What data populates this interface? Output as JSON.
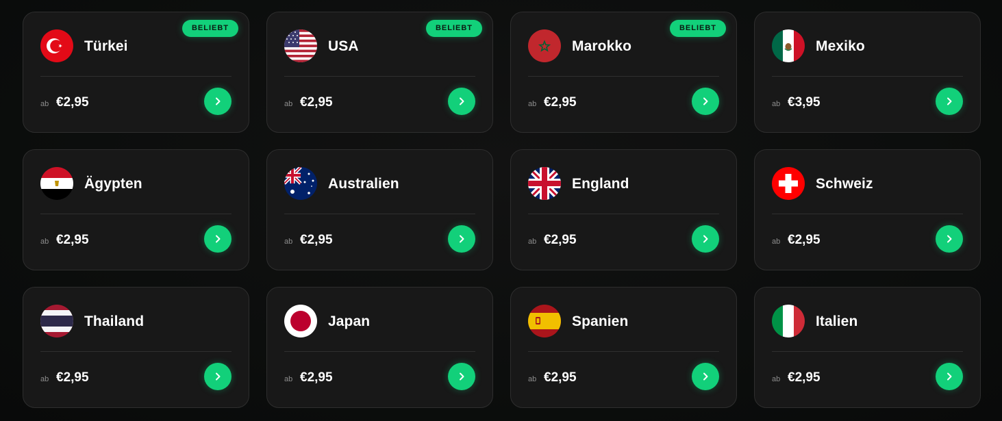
{
  "accent_color": "#12d07a",
  "price_prefix": "ab",
  "countries": [
    {
      "name": "Türkei",
      "price": "€2,95",
      "badge": "BELIEBT",
      "flag_icon": "turkey-flag-icon"
    },
    {
      "name": "USA",
      "price": "€2,95",
      "badge": "BELIEBT",
      "flag_icon": "usa-flag-icon"
    },
    {
      "name": "Marokko",
      "price": "€2,95",
      "badge": "BELIEBT",
      "flag_icon": "morocco-flag-icon"
    },
    {
      "name": "Mexiko",
      "price": "€3,95",
      "flag_icon": "mexico-flag-icon"
    },
    {
      "name": "Ägypten",
      "price": "€2,95",
      "flag_icon": "egypt-flag-icon"
    },
    {
      "name": "Australien",
      "price": "€2,95",
      "flag_icon": "australia-flag-icon"
    },
    {
      "name": "England",
      "price": "€2,95",
      "flag_icon": "england-flag-icon"
    },
    {
      "name": "Schweiz",
      "price": "€2,95",
      "flag_icon": "switzerland-flag-icon"
    },
    {
      "name": "Thailand",
      "price": "€2,95",
      "flag_icon": "thailand-flag-icon"
    },
    {
      "name": "Japan",
      "price": "€2,95",
      "flag_icon": "japan-flag-icon"
    },
    {
      "name": "Spanien",
      "price": "€2,95",
      "flag_icon": "spain-flag-icon"
    },
    {
      "name": "Italien",
      "price": "€2,95",
      "flag_icon": "italy-flag-icon"
    }
  ]
}
